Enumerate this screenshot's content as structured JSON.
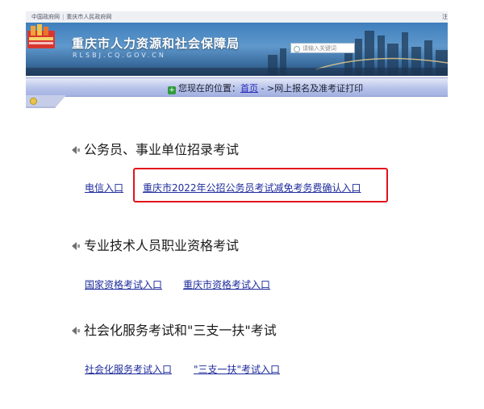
{
  "topbar": {
    "links": [
      "中国政府网",
      "重庆市人民政府网"
    ],
    "login": "注"
  },
  "banner": {
    "title": "重庆市人力资源和社会保障局",
    "domain": "RLSBJ.CQ.GOV.CN",
    "search_placeholder": "请输入关键词"
  },
  "breadcrumb": {
    "prefix": "您现在的位置：",
    "home": "首页",
    "separator": " - >",
    "current": "网上报名及准考证打印"
  },
  "sections": [
    {
      "title": "公务员、事业单位招录考试",
      "links": [
        "电信入口",
        "重庆市2022年公招公务员考试减免考务费确认入口"
      ]
    },
    {
      "title": "专业技术人员职业资格考试",
      "links": [
        "国家资格考试入口",
        "重庆市资格考试入口"
      ]
    },
    {
      "title": "社会化服务考试和\"三支一扶\"考试",
      "links": [
        "社会化服务考试入口",
        "\"三支一扶\"考试入口"
      ]
    }
  ],
  "colors": {
    "link": "#1f2c9c",
    "highlight": "#e2131c",
    "nav": "#b7c3ea"
  }
}
